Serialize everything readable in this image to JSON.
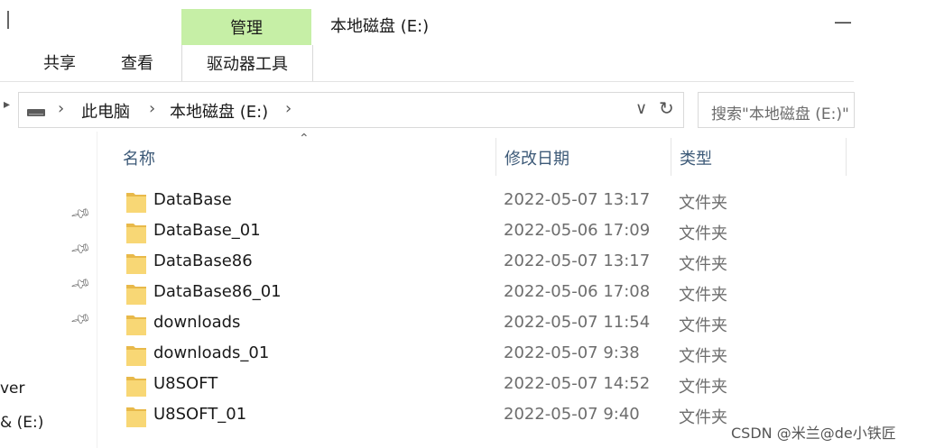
{
  "window": {
    "title": "本地磁盘 (E:)",
    "minimize_glyph": "—"
  },
  "ribbon": {
    "tabs": [
      {
        "label": "共享"
      },
      {
        "label": "查看"
      }
    ],
    "contextual_group": {
      "header": "管理",
      "tab": "驱动器工具",
      "color": "#c6efa6"
    }
  },
  "address_bar": {
    "breadcrumbs": [
      {
        "label": "此电脑"
      },
      {
        "label": "本地磁盘 (E:)"
      }
    ],
    "dropdown_glyph": "∨",
    "refresh_glyph": "↻",
    "drive_icon": "drive-icon"
  },
  "search": {
    "placeholder": "搜索\"本地磁盘 (E:)\""
  },
  "columns": [
    {
      "label": "名称"
    },
    {
      "label": "修改日期"
    },
    {
      "label": "类型"
    }
  ],
  "nav_pane": {
    "pins": 4,
    "items": [
      {
        "label": "ver"
      },
      {
        "label": "& (E:)"
      }
    ]
  },
  "files": [
    {
      "name": "DataBase",
      "date": "2022-05-07 13:17",
      "type": "文件夹"
    },
    {
      "name": "DataBase_01",
      "date": "2022-05-06 17:09",
      "type": "文件夹"
    },
    {
      "name": "DataBase86",
      "date": "2022-05-07 13:17",
      "type": "文件夹"
    },
    {
      "name": "DataBase86_01",
      "date": "2022-05-06 17:08",
      "type": "文件夹"
    },
    {
      "name": "downloads",
      "date": "2022-05-07 11:54",
      "type": "文件夹"
    },
    {
      "name": "downloads_01",
      "date": "2022-05-07 9:38",
      "type": "文件夹"
    },
    {
      "name": "U8SOFT",
      "date": "2022-05-07 14:52",
      "type": "文件夹"
    },
    {
      "name": "U8SOFT_01",
      "date": "2022-05-07 9:40",
      "type": "文件夹"
    }
  ],
  "watermark": "CSDN @米兰@de小铁匠",
  "colors": {
    "folder": "#f8d775",
    "folder_dark": "#e8b94a",
    "header_text": "#3d5a78"
  }
}
